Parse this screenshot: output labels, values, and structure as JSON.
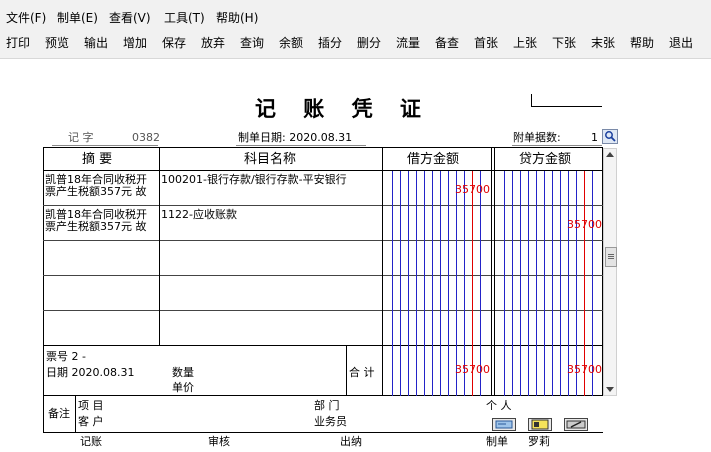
{
  "menu": [
    "文件(F)",
    "制单(E)",
    "查看(V)",
    "工具(T)",
    "帮助(H)"
  ],
  "toolbar": [
    "打印",
    "预览",
    "输出",
    "增加",
    "保存",
    "放弃",
    "查询",
    "余额",
    "插分",
    "删分",
    "流量",
    "备查",
    "首张",
    "上张",
    "下张",
    "末张",
    "帮助",
    "退出"
  ],
  "voucher": {
    "title": "记 账 凭 证",
    "type_label": "记    字",
    "number": "0382",
    "date_label": "制单日期: 2020.08.31",
    "attach_label": "附单据数:",
    "attach_count": "1"
  },
  "table": {
    "headers": {
      "summary": "摘 要",
      "account": "科目名称",
      "debit": "借方金额",
      "credit": "贷方金额"
    },
    "rows": [
      {
        "summary1": "凯普18年合同收税开",
        "summary2": "票产生税额357元 故",
        "account": "100201-银行存款/银行存款-平安银行",
        "debit": "35700",
        "credit": ""
      },
      {
        "summary1": "凯普18年合同收税开",
        "summary2": "票产生税额357元 故",
        "account": "1122-应收账款",
        "debit": "",
        "credit": "35700"
      }
    ]
  },
  "footer": {
    "ticket": "票号  2   -",
    "date": "日期  2020.08.31",
    "qty_label": "数量",
    "price_label": "单价",
    "total_label": "合 计",
    "total_debit": "35700",
    "total_credit": "35700",
    "remark_label": "备注",
    "project_label": "项  目",
    "customer_label": "客  户",
    "dept_label": "部  门",
    "staff_label": "业务员",
    "person_label": "个  人"
  },
  "signatures": {
    "bookkeep": "记账",
    "review": "审核",
    "cashier": "出纳",
    "maker_label": "制单",
    "maker_name": "罗莉"
  }
}
